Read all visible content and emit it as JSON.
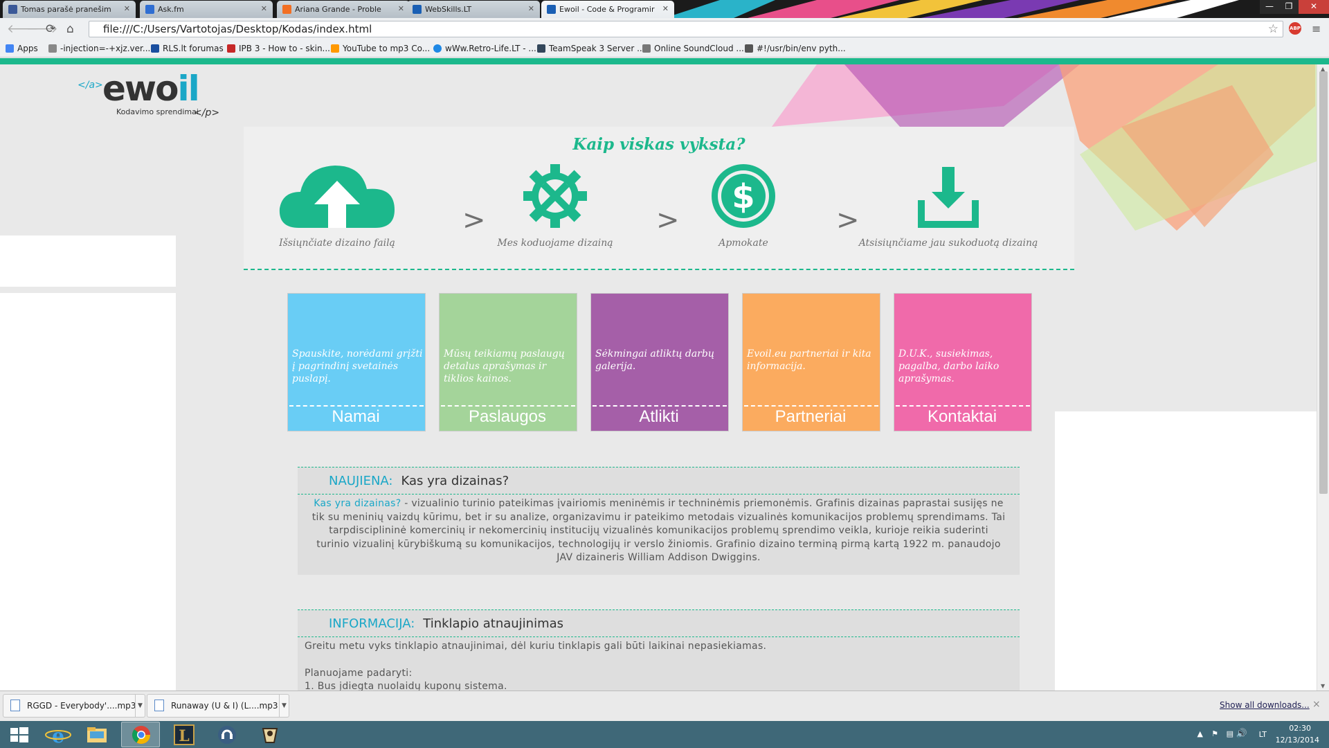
{
  "browser": {
    "tabs": [
      {
        "title": "Tomas parašė pranešim",
        "favicon_color": "#3b5998"
      },
      {
        "title": "Ask.fm",
        "favicon_color": "#2f6ed2"
      },
      {
        "title": "Ariana Grande - Proble",
        "favicon_color": "#f26f23"
      },
      {
        "title": "WebSkills.LT",
        "favicon_color": "#1a5fb4"
      },
      {
        "title": "Ewoil - Code & Programir",
        "favicon_color": "#1a5fb4",
        "active": true
      }
    ],
    "url": "file:///C:/Users/Vartotojas/Desktop/Kodas/index.html",
    "adblock_label": "ABP",
    "bookmarks": [
      {
        "label": "Apps",
        "icon_color": "#4285f4"
      },
      {
        "label": "-injection=-+xjz.ver...",
        "icon_color": "#888888"
      },
      {
        "label": "RLS.lt forumas",
        "icon_color": "#1a4fa0"
      },
      {
        "label": "IPB 3 - How to - skin...",
        "icon_color": "#c62828"
      },
      {
        "label": "YouTube to mp3 Co...",
        "icon_color": "#ff9900"
      },
      {
        "label": "wWw.Retro-Life.LT - ...",
        "icon_color": "#1e88e5"
      },
      {
        "label": "TeamSpeak 3 Server ...",
        "icon_color": "#33475b"
      },
      {
        "label": "Online SoundCloud ...",
        "icon_color": "#777777"
      },
      {
        "label": "#!/usr/bin/env pyth...",
        "icon_color": "#555555"
      }
    ]
  },
  "site": {
    "logo": {
      "tag_open": "</a>",
      "word_a": "ewo",
      "word_b": "il",
      "sub": "Kodavimo sprendimai",
      "tag_close": "</p>"
    },
    "how_title": "Kaip viskas vyksta?",
    "steps": [
      {
        "icon": "cloud-upload-icon",
        "label": "Išsiųnčiate dizaino failą"
      },
      {
        "icon": "gear-wrench-icon",
        "label": "Mes koduojame dizainą"
      },
      {
        "icon": "dollar-coin-icon",
        "label": "Apmokate"
      },
      {
        "icon": "download-tray-icon",
        "label": "Atsisiųnčiame jau sukoduotą dizainą"
      }
    ],
    "step_separator": ">",
    "tiles": [
      {
        "title": "Namai",
        "desc": "Spauskite, norėdami grįžti į pagrindinį svetainės puslapį.",
        "color": "#69cdf5"
      },
      {
        "title": "Paslaugos",
        "desc": "Mūsų teikiamų paslaugų detalus aprašymas ir tiklios kainos.",
        "color": "#a4d49a"
      },
      {
        "title": "Atlikti",
        "desc": "Sėkmingai atliktų darbų galerija.",
        "color": "#a55fa8"
      },
      {
        "title": "Partneriai",
        "desc": "Evoil.eu partneriai ir kita informacija.",
        "color": "#fbab5f"
      },
      {
        "title": "Kontaktai",
        "desc": "D.U.K., susiekimas, pagalba, darbo laiko aprašymas.",
        "color": "#f06aaa"
      }
    ],
    "news": [
      {
        "kicker": "NAUJIENA:",
        "title": "Kas yra dizainas?",
        "lead": "Kas yra dizainas?",
        "text": " - vizualinio turinio pateikimas įvairiomis meninėmis ir techninėmis priemonėmis. Grafinis dizainas paprastai susijęs ne tik su meninių vaizdų kūrimu, bet ir su analize, organizavimu ir pateikimo metodais vizualinės komunikacijos problemų sprendimams. Tai tarpdisciplininė komercinių ir nekomercinių institucijų vizualinės komunikacijos problemų sprendimo veikla, kurioje reikia suderinti turinio vizualinį kūrybiškumą su komunikacijos, technologijų ir verslo žiniomis. Grafinio dizaino terminą pirmą kartą 1922 m. panaudojo JAV dizaineris William Addison Dwiggins."
      },
      {
        "kicker": "INFORMACIJA:",
        "title": "Tinklapio atnaujinimas",
        "line1": "Greitu metu vyks tinklapio atnaujinimai, dėl kuriu tinklapis gali būti laikinai nepasiekiamas.",
        "line2": "Planuojame padaryti:",
        "line3": "1. Bus įdiegta nuolaidų kuponų sistema."
      }
    ]
  },
  "downloads": {
    "items": [
      "RGGD - Everybody'....mp3",
      "Runaway (U & I) (L....mp3"
    ],
    "show_all": "Show all downloads...",
    "close": "×"
  },
  "taskbar": {
    "apps": [
      "start",
      "internet-explorer",
      "file-explorer",
      "chrome",
      "league-of-legends",
      "teamspeak",
      "app-6"
    ],
    "lang": "LT",
    "time": "02:30",
    "date": "12/13/2014"
  }
}
